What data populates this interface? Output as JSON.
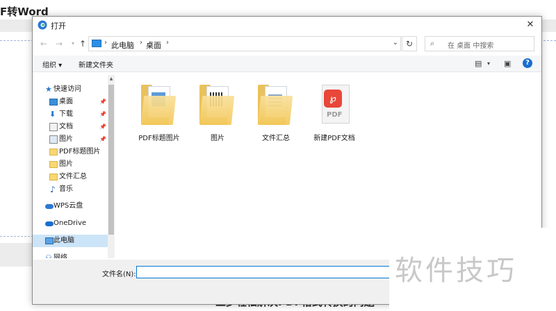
{
  "background": {
    "page_title": "F转Word",
    "bottom_text": "三步轻松解决PDF格式转换的问题"
  },
  "dialog": {
    "title": "打开",
    "close_glyph": "✕",
    "address": [
      "此电脑",
      "桌面"
    ],
    "search_placeholder": "在 桌面 中搜索",
    "toolbar": {
      "organize": "组织 ▾",
      "new_folder": "新建文件夹",
      "help": "?"
    },
    "sidebar": [
      {
        "label": "快速访问",
        "icon": "star"
      },
      {
        "label": "桌面",
        "icon": "desktop",
        "pinned": true
      },
      {
        "label": "下载",
        "icon": "download",
        "pinned": true
      },
      {
        "label": "文档",
        "icon": "document",
        "pinned": true
      },
      {
        "label": "图片",
        "icon": "pictures",
        "pinned": true
      },
      {
        "label": "PDF标题图片",
        "icon": "folder"
      },
      {
        "label": "图片",
        "icon": "folder"
      },
      {
        "label": "文件汇总",
        "icon": "folder"
      },
      {
        "label": "音乐",
        "icon": "music"
      },
      {
        "label": "WPS云盘",
        "icon": "cloud"
      },
      {
        "label": "OneDrive",
        "icon": "cloud"
      },
      {
        "label": "此电脑",
        "icon": "computer",
        "selected": true
      },
      {
        "label": "网络",
        "icon": "network"
      }
    ],
    "files": [
      {
        "name": "PDF标题图片",
        "type": "folder"
      },
      {
        "name": "图片",
        "type": "folder"
      },
      {
        "name": "文件汇总",
        "type": "folder"
      },
      {
        "name": "新建PDF文档",
        "type": "pdf",
        "badge": "PDF"
      }
    ],
    "filename_label": "文件名(N):",
    "filename_value": ""
  },
  "watermark": "软件技巧",
  "colors": {
    "selection": "#cce4f7",
    "accent": "#0078d7",
    "pdf_red": "#e8473a",
    "folder": "#f3c85a"
  }
}
